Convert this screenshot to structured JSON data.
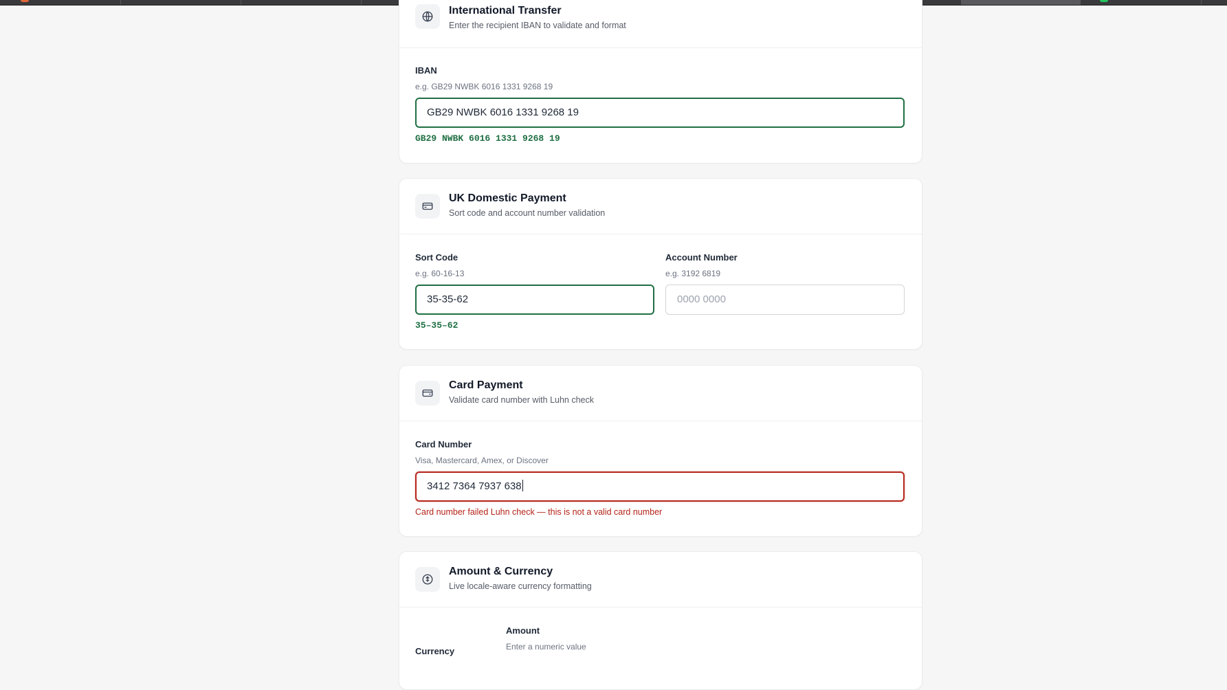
{
  "browser": {
    "colors": {
      "tab_bar": "#3a3a3c",
      "active_tab": "#5a5a5e"
    }
  },
  "colors": {
    "valid": "#1f6f43",
    "invalid": "#b42318",
    "muted": "#6b7280"
  },
  "international": {
    "icon": "globe-icon",
    "title": "International Transfer",
    "subtitle": "Enter the recipient IBAN to validate and format",
    "iban": {
      "label": "IBAN",
      "hint": "e.g. GB29 NWBK 6016 1331 9268 19",
      "value": "GB29 NWBK 6016 1331 9268 19",
      "formatted": "GB29 NWBK 6016 1331 9268 19",
      "state": "valid"
    }
  },
  "domestic": {
    "icon": "bank-card-icon",
    "title": "UK Domestic Payment",
    "subtitle": "Sort code and account number validation",
    "sort_code": {
      "label": "Sort Code",
      "hint": "e.g. 60-16-13",
      "value": "35-35-62",
      "formatted": "35–35–62",
      "state": "valid"
    },
    "account_number": {
      "label": "Account Number",
      "hint": "e.g. 3192 6819",
      "placeholder": "0000 0000",
      "value": ""
    }
  },
  "card_payment": {
    "icon": "credit-card-icon",
    "title": "Card Payment",
    "subtitle": "Validate card number with Luhn check",
    "card_number": {
      "label": "Card Number",
      "hint": "Visa, Mastercard, Amex, or Discover",
      "value": "3412 7364 7937 638",
      "state": "invalid",
      "error": "Card number failed Luhn check — this is not a valid card number"
    }
  },
  "amount_currency": {
    "icon": "currency-exchange-icon",
    "title": "Amount & Currency",
    "subtitle": "Live locale-aware currency formatting",
    "currency_label": "Currency",
    "amount": {
      "label": "Amount",
      "hint": "Enter a numeric value"
    }
  }
}
